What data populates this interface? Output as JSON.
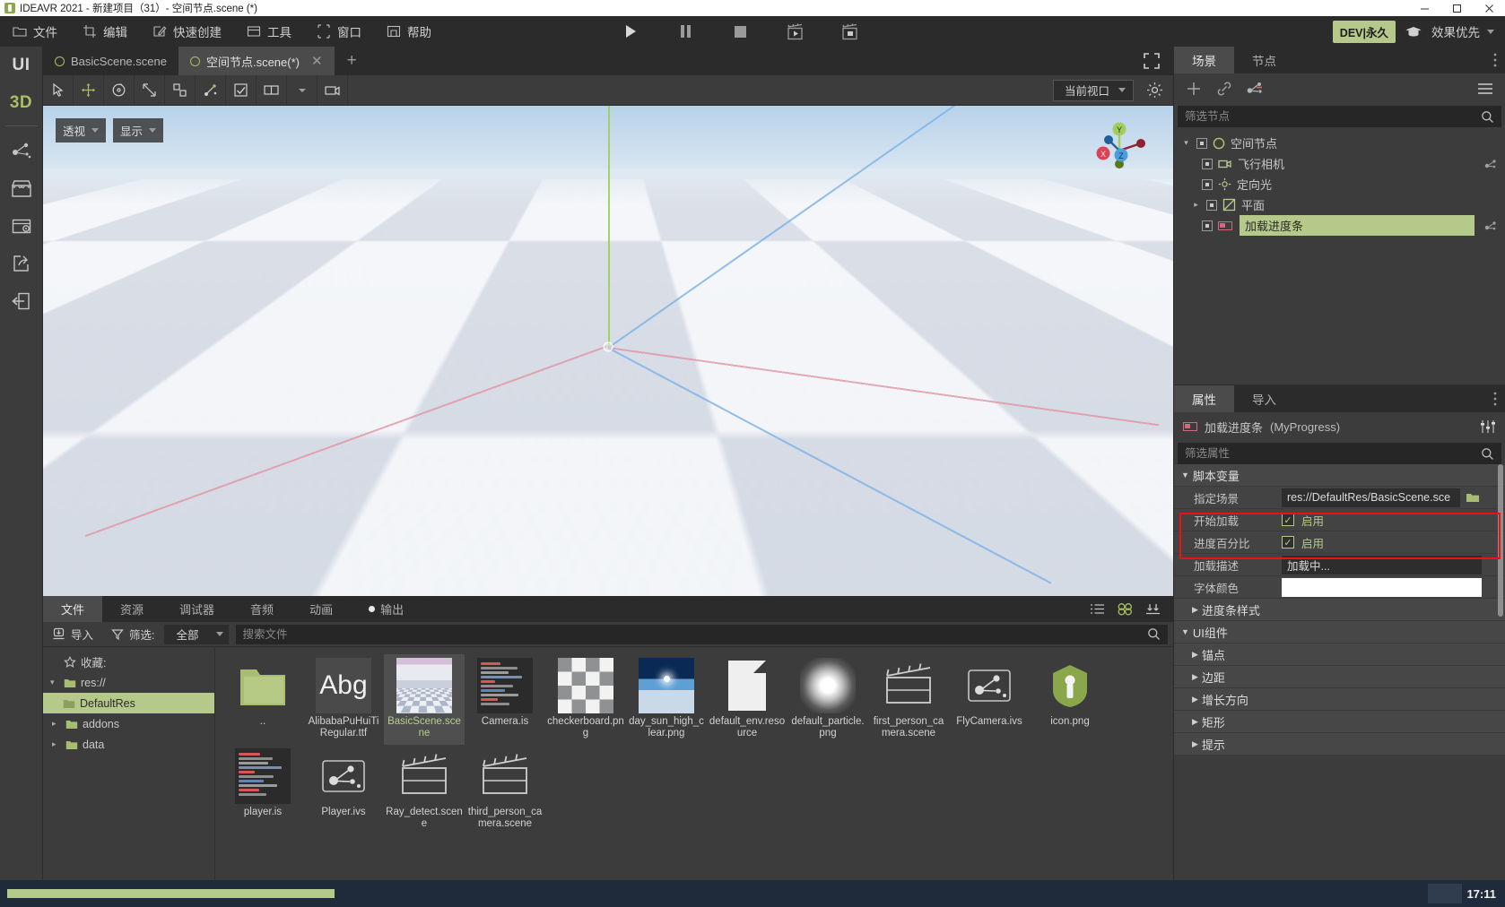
{
  "window": {
    "title": "IDEAVR 2021 - 新建项目（31）- 空间节点.scene (*)",
    "minimize": "—",
    "maximize": "▭",
    "close": "✕"
  },
  "menubar": {
    "items": [
      {
        "label": "文件",
        "icon": "folder-icon"
      },
      {
        "label": "编辑",
        "icon": "crop-icon"
      },
      {
        "label": "快速创建",
        "icon": "pencil-square-icon"
      },
      {
        "label": "工具",
        "icon": "window-icon"
      },
      {
        "label": "窗口",
        "icon": "frame-icon"
      },
      {
        "label": "帮助",
        "icon": "book-icon"
      }
    ],
    "playback": [
      {
        "name": "play-button",
        "icon": "play-icon"
      },
      {
        "name": "pause-button",
        "icon": "pause-icon"
      },
      {
        "name": "stop-button",
        "icon": "stop-icon"
      },
      {
        "name": "movie-play-button",
        "icon": "clapperboard-play-icon"
      },
      {
        "name": "movie-record-button",
        "icon": "clapperboard-record-icon"
      }
    ],
    "dev_badge": "DEV|永久",
    "graduation_icon": "graduation-cap-icon",
    "quality_select": "效果优先"
  },
  "rail": {
    "tabs": [
      {
        "label": "UI",
        "active": false
      },
      {
        "label": "3D",
        "active": true
      }
    ],
    "icons": [
      "node-graph-icon",
      "store-icon",
      "window-settings-icon",
      "share-export-icon",
      "import-door-icon"
    ]
  },
  "scene_tabs": {
    "tabs": [
      {
        "label": "BasicScene.scene",
        "active": false,
        "closable": false
      },
      {
        "label": "空间节点.scene(*)",
        "active": true,
        "closable": true
      }
    ],
    "add_label": "+",
    "expand_icon": "expand-icon"
  },
  "viewport_toolbar": {
    "tools": [
      {
        "name": "select-tool",
        "icon": "cursor-icon",
        "selected": false
      },
      {
        "name": "move-tool",
        "icon": "move-arrows-icon",
        "selected": false
      },
      {
        "name": "rotate-tool",
        "icon": "rotate-icon",
        "selected": false
      },
      {
        "name": "scale-tool",
        "icon": "scale-icon",
        "selected": false
      },
      {
        "name": "transform-tool",
        "icon": "transform-icon",
        "selected": false
      },
      {
        "name": "pivot-tool",
        "icon": "pivot-icon",
        "selected": false
      },
      {
        "name": "snap-tool",
        "icon": "snap-check-icon",
        "selected": false
      },
      {
        "name": "layout-tool",
        "icon": "layout-icon",
        "selected": false
      },
      {
        "name": "camera-tool",
        "icon": "camera-icon",
        "selected": false
      }
    ],
    "viewport_select": "当前视口",
    "gear_icon": "gear-icon"
  },
  "viewport": {
    "overlay_buttons": [
      {
        "label": "透视",
        "name": "perspective-dropdown"
      },
      {
        "label": "显示",
        "name": "display-dropdown"
      }
    ],
    "gizmo_axes": [
      {
        "label": "X",
        "color": "#e04055"
      },
      {
        "label": "Y",
        "color": "#9fce5a"
      },
      {
        "label": "Z",
        "color": "#4a9ee0"
      }
    ]
  },
  "bottom_panel": {
    "tabs": [
      {
        "label": "文件",
        "active": true,
        "dot": false
      },
      {
        "label": "资源",
        "active": false,
        "dot": false
      },
      {
        "label": "调试器",
        "active": false,
        "dot": false
      },
      {
        "label": "音频",
        "active": false,
        "dot": false
      },
      {
        "label": "动画",
        "active": false,
        "dot": false
      },
      {
        "label": "输出",
        "active": false,
        "dot": true
      }
    ],
    "right_icons": [
      "list-view-icon",
      "grid-view-icon",
      "sort-down-icon"
    ],
    "toolbar": {
      "import_label": "导入",
      "import_icon": "import-icon",
      "filter_label": "筛选:",
      "filter_icon": "funnel-icon",
      "filter_value": "全部",
      "search_placeholder": "搜索文件",
      "search_value": "",
      "search_icon": "search-icon"
    },
    "tree": [
      {
        "label": "收藏:",
        "icon": "star-icon",
        "indent": 0,
        "arrow": "",
        "selected": false
      },
      {
        "label": "res://",
        "icon": "folder-icon",
        "indent": 0,
        "arrow": "▾",
        "selected": false
      },
      {
        "label": "DefaultRes",
        "icon": "folder-icon",
        "indent": 1,
        "arrow": "",
        "selected": true
      },
      {
        "label": "addons",
        "icon": "folder-icon",
        "indent": 1,
        "arrow": "▸",
        "selected": false
      },
      {
        "label": "data",
        "icon": "folder-icon",
        "indent": 1,
        "arrow": "▸",
        "selected": false
      }
    ],
    "files": [
      {
        "name": "..",
        "thumb": "folder",
        "selected": false
      },
      {
        "name": "AlibabaPuHuiTiRegular.ttf",
        "thumb": "font",
        "selected": false
      },
      {
        "name": "BasicScene.scene",
        "thumb": "scene",
        "selected": true
      },
      {
        "name": "Camera.is",
        "thumb": "code",
        "selected": false
      },
      {
        "name": "checkerboard.png",
        "thumb": "checker",
        "selected": false
      },
      {
        "name": "day_sun_high_clear.png",
        "thumb": "sky",
        "selected": false
      },
      {
        "name": "default_env.resource",
        "thumb": "doc",
        "selected": false
      },
      {
        "name": "default_particle.png",
        "thumb": "blob",
        "selected": false
      },
      {
        "name": "first_person_camera.scene",
        "thumb": "clapper",
        "selected": false
      },
      {
        "name": "FlyCamera.ivs",
        "thumb": "nodegraph",
        "selected": false
      },
      {
        "name": "icon.png",
        "thumb": "iconpng",
        "selected": false
      },
      {
        "name": "player.is",
        "thumb": "code",
        "selected": false
      },
      {
        "name": "Player.ivs",
        "thumb": "nodegraph",
        "selected": false
      },
      {
        "name": "Ray_detect.scene",
        "thumb": "clapper",
        "selected": false
      },
      {
        "name": "third_person_camera.scene",
        "thumb": "clapper",
        "selected": false
      }
    ]
  },
  "right_dock": {
    "tabs": [
      {
        "label": "场景",
        "active": true
      },
      {
        "label": "节点",
        "active": false
      }
    ],
    "menu_dots_icon": "vertical-dots-icon",
    "toolbar": [
      {
        "name": "add-node-button",
        "icon": "plus-icon"
      },
      {
        "name": "link-scene-button",
        "icon": "link-icon"
      },
      {
        "name": "attach-script-button",
        "icon": "script-node-icon"
      },
      {
        "name": "tree-menu-button",
        "icon": "hamburger-icon"
      }
    ],
    "filter_placeholder": "筛选节点",
    "filter_value": "",
    "filter_icon": "search-icon",
    "nodes": [
      {
        "label": "空间节点",
        "indent": 0,
        "arrow": "▾",
        "icon": "circle-node-icon",
        "selected": false,
        "script": false
      },
      {
        "label": "飞行相机",
        "indent": 1,
        "arrow": "",
        "icon": "camera-node-icon",
        "selected": false,
        "script": true
      },
      {
        "label": "定向光",
        "indent": 1,
        "arrow": "",
        "icon": "sun-node-icon",
        "selected": false,
        "script": false
      },
      {
        "label": "平面",
        "indent": 1,
        "arrow": "▸",
        "icon": "plane-node-icon",
        "selected": false,
        "script": false
      },
      {
        "label": "加载进度条",
        "indent": 1,
        "arrow": "",
        "icon": "progressbar-node-icon",
        "selected": true,
        "script": true
      }
    ]
  },
  "inspector": {
    "tabs": [
      {
        "label": "属性",
        "active": true
      },
      {
        "label": "导入",
        "active": false
      }
    ],
    "menu_dots_icon": "vertical-dots-icon",
    "header": {
      "icon": "progressbar-node-icon",
      "node_name": "加载进度条",
      "class_name": "(MyProgress)",
      "settings_icon": "sliders-icon"
    },
    "filter_placeholder": "筛选属性",
    "filter_value": "",
    "filter_icon": "search-icon",
    "sections": [
      {
        "title": "脚本变量",
        "expanded": true,
        "rows": [
          {
            "label": "指定场景",
            "type": "path",
            "value": "res://DefaultRes/BasicScene.sce",
            "folder_icon": "folder-open-icon",
            "highlighted": true
          },
          {
            "label": "开始加载",
            "type": "check",
            "value": "启用",
            "checked": true,
            "highlighted": true
          },
          {
            "label": "进度百分比",
            "type": "check",
            "value": "启用",
            "checked": true,
            "highlighted": false
          },
          {
            "label": "加载描述",
            "type": "text",
            "value": "加载中...",
            "highlighted": false
          },
          {
            "label": "字体颜色",
            "type": "color",
            "value": "#ffffff",
            "highlighted": false
          }
        ]
      },
      {
        "title": "进度条样式",
        "expanded": false,
        "rows": []
      },
      {
        "title": "UI组件",
        "expanded": true,
        "rows": []
      },
      {
        "title": "锚点",
        "expanded": false,
        "sub": true,
        "rows": []
      },
      {
        "title": "边距",
        "expanded": false,
        "sub": true,
        "rows": []
      },
      {
        "title": "增长方向",
        "expanded": false,
        "sub": true,
        "rows": []
      },
      {
        "title": "矩形",
        "expanded": false,
        "sub": true,
        "rows": []
      },
      {
        "title": "提示",
        "expanded": false,
        "sub": true,
        "rows": []
      }
    ]
  },
  "statusbar": {
    "time": "17:11"
  },
  "colors": {
    "accent_green": "#b5c98a",
    "highlight_red": "#ee1111",
    "panel_bg": "#3c3c3c",
    "dark_bg": "#2b2b2b",
    "axis_x": "#e04055",
    "axis_y": "#9fce5a",
    "axis_z": "#4a9ee0"
  }
}
